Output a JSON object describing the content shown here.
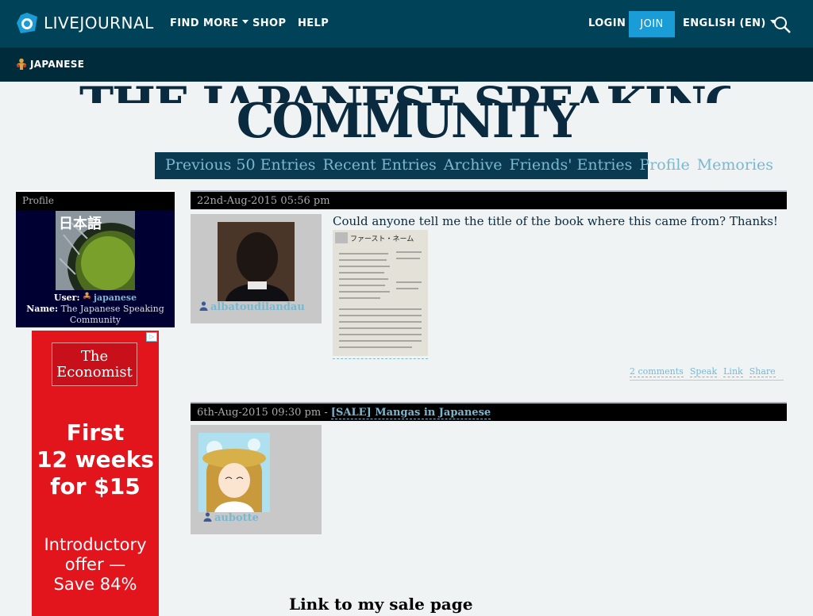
{
  "topnav": {
    "logo_text": "LIVEJOURNAL",
    "find_more": "FIND MORE",
    "shop": "SHOP",
    "help": "HELP",
    "login": "LOGIN",
    "join": "JOIN",
    "language": "ENGLISH (EN)"
  },
  "subnav": {
    "community": "JAPANESE"
  },
  "header": {
    "title": "COMMUNITY",
    "links": [
      "Previous 50 Entries",
      "Recent Entries",
      "Archive",
      "Friends' Entries",
      "Profile",
      "Memories"
    ]
  },
  "profile": {
    "heading": "Profile",
    "image_text": "日本語",
    "user_label": "User:",
    "user_name": "japanese",
    "name_label": "Name:",
    "name_value": "The Japanese Speaking Community"
  },
  "ad": {
    "logo_line1": "The",
    "logo_line2": "Economist",
    "headline": [
      "First",
      "12 weeks",
      "for $15"
    ],
    "sub": [
      "Introductory",
      "offer —",
      "Save 84%"
    ],
    "colors": {
      "background": "#e2141c"
    }
  },
  "entries": [
    {
      "date": "22nd-Aug-2015 05:56 pm",
      "poster": "albatoudilandau",
      "text": "Could anyone tell me the title of the book where this came from? Thanks!",
      "image_heading": "ファースト・ネーム",
      "actions": [
        "2 comments",
        "Speak",
        "Link",
        "Share"
      ]
    },
    {
      "date": "6th-Aug-2015 09:30 pm",
      "separator": " - ",
      "subject": "[SALE] Mangas in Japanese",
      "poster": "aubotte",
      "sale_text": "Link to my sale page"
    }
  ],
  "colors": {
    "topnav": "#004359",
    "subnav": "#002b3a",
    "accent": "#1a9dd6",
    "link": "#7ab8d0",
    "title": "#0a2a3f"
  }
}
